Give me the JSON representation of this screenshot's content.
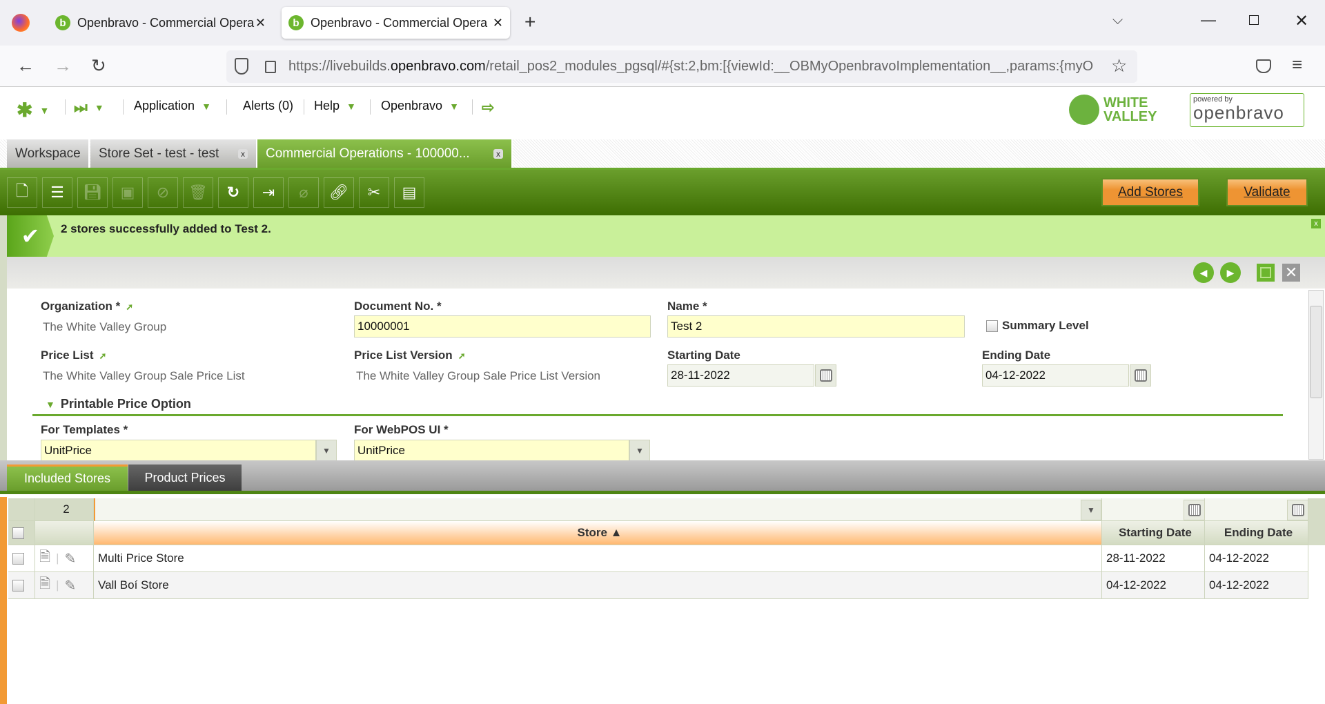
{
  "browser": {
    "tabs": [
      {
        "title": "Openbravo - Commercial Opera"
      },
      {
        "title": "Openbravo - Commercial Opera"
      }
    ],
    "url_prefix": "https://livebuilds.",
    "url_domain": "openbravo.com",
    "url_rest": "/retail_pos2_modules_pgsql/#{st:2,bm:[{viewId:__OBMyOpenbravoImplementation__,params:{myO"
  },
  "menu": {
    "application": "Application",
    "alerts": "Alerts (0)",
    "help": "Help",
    "openbravo": "Openbravo"
  },
  "logos": {
    "white_valley": "WHITE VALLEY",
    "powered_by": "powered by",
    "openbravo": "openbravo"
  },
  "main_tabs": [
    {
      "label": "Workspace"
    },
    {
      "label": "Store Set - test - test"
    },
    {
      "label": "Commercial Operations - 100000..."
    }
  ],
  "toolbar": {
    "add_stores": "Add Stores",
    "validate": "Validate"
  },
  "message": "2 stores successfully added to Test 2.",
  "form": {
    "organization_label": "Organization *",
    "organization": "The White Valley Group",
    "docno_label": "Document No. *",
    "docno": "10000001",
    "name_label": "Name *",
    "name": "Test 2",
    "summary_label": "Summary Level",
    "pricelist_label": "Price List",
    "pricelist": "The White Valley Group Sale Price List",
    "plv_label": "Price List Version",
    "plv": "The White Valley Group Sale Price List Version",
    "start_label": "Starting Date",
    "start": "28-11-2022",
    "end_label": "Ending Date",
    "end": "04-12-2022",
    "section": "Printable Price Option",
    "templates_label": "For Templates *",
    "templates": "UnitPrice",
    "webpos_label": "For WebPOS UI *",
    "webpos": "UnitPrice"
  },
  "subtabs": [
    {
      "label": "Included Stores"
    },
    {
      "label": "Product Prices"
    }
  ],
  "grid": {
    "count": "2",
    "headers": {
      "store": "Store ▲",
      "start": "Starting Date",
      "end": "Ending Date"
    },
    "rows": [
      {
        "store": "Multi Price Store",
        "start": "28-11-2022",
        "end": "04-12-2022"
      },
      {
        "store": "Vall Boí Store",
        "start": "04-12-2022",
        "end": "04-12-2022"
      }
    ]
  }
}
